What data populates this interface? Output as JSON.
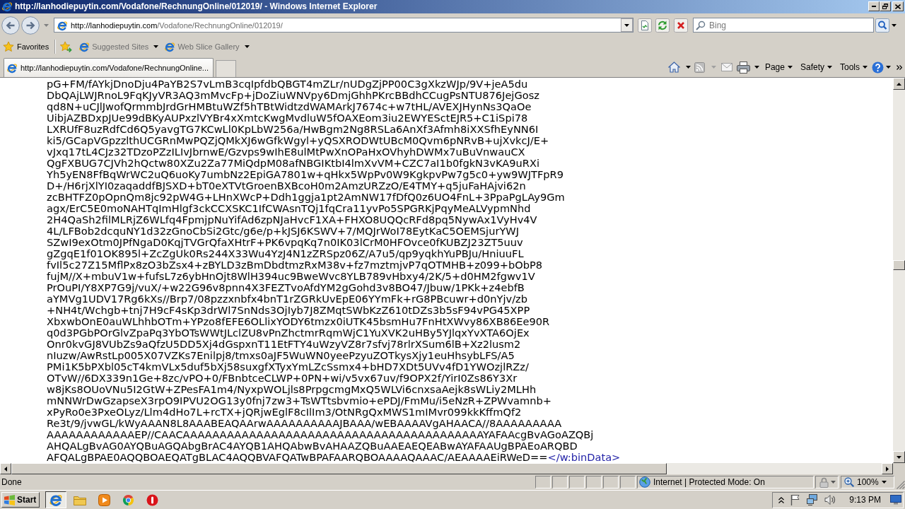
{
  "window": {
    "title": "http://lanhodiepuytin.com/Vodafone/RechnungOnline/012019/ - Windows Internet Explorer"
  },
  "address_bar": {
    "host": "http://lanhodiepuytin.com",
    "path": "/Vodafone/RechnungOnline/012019/"
  },
  "search": {
    "placeholder": "Bing"
  },
  "favorites_bar": {
    "label": "Favorites",
    "items": [
      {
        "label": "Suggested Sites"
      },
      {
        "label": "Web Slice Gallery"
      }
    ]
  },
  "tabs": [
    {
      "label": "http://lanhodiepuytin.com/Vodafone/RechnungOnline...",
      "selected": true
    }
  ],
  "command_bar": {
    "menus": [
      {
        "label": "Page"
      },
      {
        "label": "Safety"
      },
      {
        "label": "Tools"
      }
    ]
  },
  "document": {
    "lines": [
      "pG+FM/fAYkjDnoDju4PaYB2S7vLmB3cqIpfdbQBGT4mZLr/nUDgZjPP00C3gXkzWJp/9V+jeA5du",
      "DbQAjLWJRnoL9FqKJyVR3AQ3mMvcFp+jDoZiuWNVpy6DmjGhhPKrcBBdhCCugPsNTU876JejGosz",
      "qd8N+uCJlJwofQrmmbJrdGrHMBtuWZf5hTBtWidtzdWAMArkJ7674c+w7tHL/AVEXJHynNs3QaOe",
      "UibjAZBDxpJUe99dBKyAUPxzlVYBr4xXmtcKwgMvdluW5fOAXEom3iu2EWYESctEJR5+C1iSpi78",
      "LXRUfF8uzRdfCd6Q5yavgTG7KCwLl0KpLbW256a/HwBgm2Ng8RSLa6AnXf3Afmh8iXXSfhEyNN6I",
      "ki5/GCapVGpzzlthUCGRnMwPQZjQMkXJ6wGfkWgyl+yQSXRODWtUBcM0Qvm6pNRvB+ujXvkcJ/E+",
      "vJxq17tL4CJz32TDzoPZzILIvJbrnwE/Gzvps9wIhE8ulMtPwXnOPaHxOVhyhDWMx7uBuVnwauCX",
      "QgFXBUG7CJVh2hQctw80XZu2Za77MiQdpM08afNBGIKtbI4lmXvVM+CZC7aI1b0fgkN3vKA9uRXi",
      "Yh5yEN8FfBqWrWC2uQ6uoKy7umbNz2EpiGA7801w+qHkx5WpPv0W9KgkpvPw7g5c0+yw9WJTFpR9",
      "D+/H6rjXlYI0zaqaddfBJSXD+bT0eXTVtGroenBXBcoH0m2AmzURZzO/E4TMY+q5juFaHAjvi62n",
      "zcBHTFZ0pOpnQm8jc92pW4G+LHnXWcP+Ddh1ggja1pt2AmNW17fDfQ0z6UO4FnL+3PpaPgLAy9Gm",
      "agx/ErC5E0moNAHTqImHlgf3ckCCXSKC1IfCWAsnTQj1fqCra11yvPo5SPGRKjPqyMeALVypmNhd",
      "2H4QaSh2filMLRjZ6WLfq4FpmjpNuYifAd6zpNJaHvcF1XA+FHXO8UQQcRFd8pq5NywAx1VyHv4V",
      "4L/LFBob2dcquNY1d32zGnoCbSi2Gtc/g6e/p+kJSJ6KSWV+7/MQJrWoI78EytKaC5OEMSjurYWJ",
      "SZwI9exOtm0JPfNgaD0KqjTVGrQfaXHtrF+PK6vpqKq7n0IK03lCrM0HFOvce0fKUBZJ23ZT5uuv",
      "gZgqE1f01OK895l+ZcZgUk0Rs244X33Wu4YzJ4N1zZRSpz06Z/A7u5/qp9yqkhYuPBJu/HniuuFL",
      "fvIl5c27Z15MflPx8zO3bZsx4+zBYLD3zBmDbdtmzRxM38v+fz7mztmjvP7qOTMHB+z099+bObP8",
      "fujM//X+mbuV1w+fufsL7z6ybHnOjt8WlH394uc9BweWvc8YLB789vHbxy4/2K/5+d0HM2fgwv1V",
      "PrOuPI/Y8XP7G9j/vuX/+w22G96v8pnn4X3FEZTvoAfdYM2gGohd3v8BO47/Jbuw/1PKk+z4ebfB",
      "aYMVg1UDV17Rg6kXs//Brp7/08pzzxnbfx4bnT1rZGRkUvEpE06YYmFk+rG8PBcuwr+d0nYjv/zb",
      "+NH4t/Wchgb+tnj7H9cF4sKp3drWl7SnNds3OjIyb7J8ZMqtSWbKzZ610tDZs3b5sF94vPG45XPP",
      "XbxwbOnE0auWLhhbOTm+YPzo8fEFE6OLlixYODY6tmzx0iUTK45bsmHu7FnHtXWvy86XB86Ee90R",
      "q0d3PGbPOrGlvZpaPq3YbOTsWWtJLclZU8vPnZhctmrRqmWjC1YuXVK2uHBy5YJlqxYvXTA6OjEx",
      "Onr0kvGJ8VUbZs9aQfzU5DD5Xj4dGspxnT11EtFTY4uWzyVZ8r7sfvj78rlrXSum6lB+Xz2lusm2",
      "nIuzw/AwRstLp005X07VZKs7Enilpj8/tmxs0aJF5WuWN0yeePzyuZOTkysXjy1euHhsybLFS/A5",
      "PMi1K5bPXbl05cT4kmVLx5duf5bXj58suxgfXTyxYmLZcSsmx4+bHD7XDt5UVv4fD1YWOzjlRZz/",
      "OTvW//6DX339n1Ge+8zc/vPO+0/FBnbtceCLWP+0PN+wi/v5vx67uv/f9OPX2f/YirI0Zs86Y3Xr",
      "w8jKs8OUoVNu5I2GtW+ZPesFA1m4/NyxpWOLjls8PrpgcmgMxQ5WLVi6cnxsaAejk8sWLiy2MLHh",
      "mNNWrDwGzapseX3rpO9IPVU2OG13y0fnj7zw3+TsWTtsbvmio+ePDJ/FmMu/i5eNzR+ZPWvamnb+",
      "xPyRo0e3PxeOLyz/Llm4dHo7L+rcTX+jQRjwEglF8cIlIm3/OtNRgQxMWS1mIMvr099kkKffmQf2",
      "Re3t/9/jvwGL/kWyAAAN8L8AAABEAQAArwAAAAAAAAAAJBAAA/wEBAAAAVgAHAACA//8AAAAAAAAA",
      "AAAAAAAAAAAAEP//CAACAAAAAAAAAAAAAAAAAAAAAAAAAAAAAAAAAAAAAAAAAYAFAAcgBvAGoAZQBj",
      "AHQALgBvAG0AYQBuAGQAbgBrAC4AYQB1AHQAbwBvAHAAZQBuAAEAEQEABwAYAFAAUgBPAEoARQBD",
      "AFQALgBPAE0AQQBOAEQATgBLAC4AQQBVAFQATwBPAFAARQBOAAAAQAAAC/AEAAAAEiRWeD=="
    ],
    "closing_tag": "</w:binData>"
  },
  "status_bar": {
    "text": "Done",
    "zone": "Internet | Protected Mode: On",
    "zoom": "100%"
  },
  "taskbar": {
    "start": "Start",
    "buttons": [
      {
        "selected": true
      },
      {
        "selected": false
      },
      {
        "selected": false
      },
      {
        "selected": false
      },
      {
        "selected": false
      }
    ],
    "clock": "9:13 PM"
  }
}
